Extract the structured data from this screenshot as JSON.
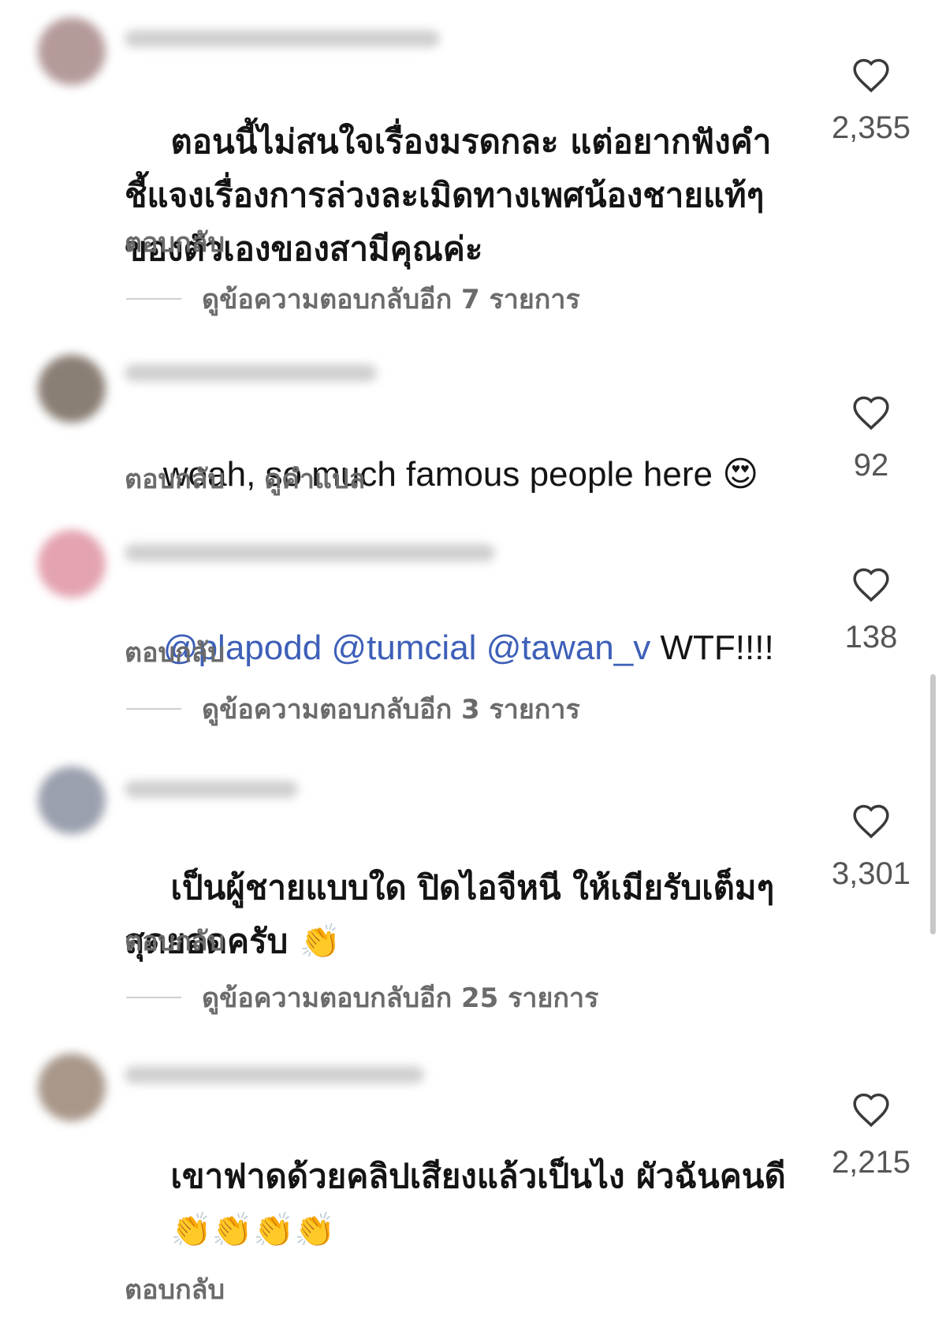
{
  "labels": {
    "reply": "ตอบกลับ",
    "see_translation": "ดูคำแปล"
  },
  "comments": [
    {
      "text": "ตอนนี้ไม่สนใจเรื่องมรดกละ แต่อยากฟังคำชี้แจงเรื่องการล่วงละเมิดทางเพศน้องชายแท้ๆของตัวเองของสามีคุณค่ะ",
      "likes": "2,355",
      "view_replies": "ดูข้อความตอบกลับอีก 7 รายการ"
    },
    {
      "text": "woah, so much famous people here",
      "emoji": "😍",
      "likes": "92"
    },
    {
      "mentions": [
        "@plapodd",
        "@tumcial",
        "@tawan_v"
      ],
      "text": "WTF!!!!",
      "likes": "138",
      "view_replies": "ดูข้อความตอบกลับอีก 3 รายการ"
    },
    {
      "text": "เป็นผู้ชายแบบใด ปิดไอจีหนี ให้เมียรับเต็มๆ สุดยอดครับ",
      "emoji": "👏",
      "likes": "3,301",
      "view_replies": "ดูข้อความตอบกลับอีก 25 รายการ"
    },
    {
      "text": "เขาฟาดด้วยคลิปเสียงแล้วเป็นไง ผัวฉันคนดี",
      "emoji": "👏👏👏👏",
      "likes": "2,215"
    }
  ]
}
